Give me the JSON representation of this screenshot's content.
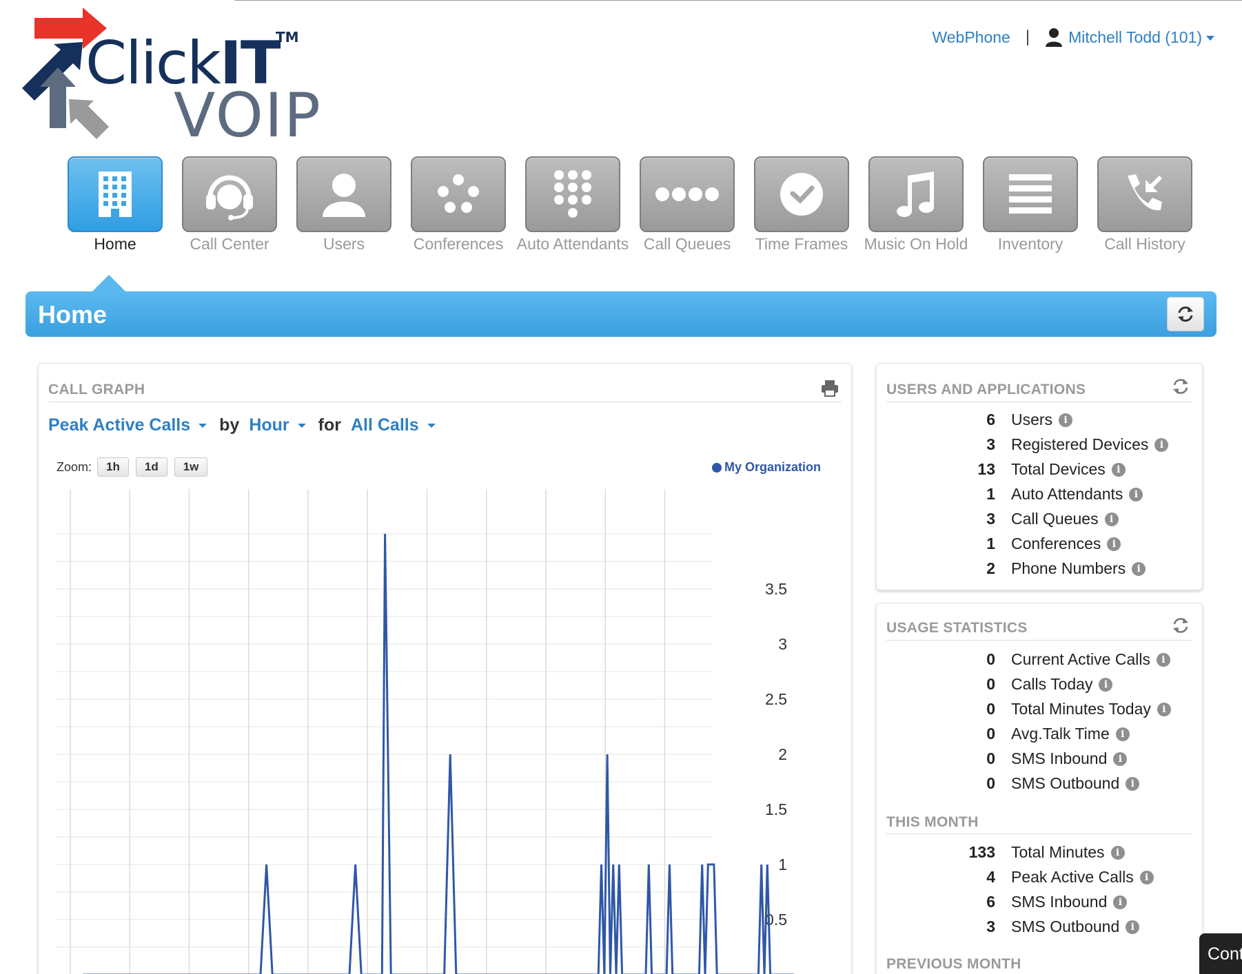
{
  "logo": {
    "word_click": "Click",
    "word_it": "IT",
    "tm": "TM",
    "word_voip": "VOIP"
  },
  "header": {
    "webphone": "WebPhone",
    "separator": "|",
    "user": "Mitchell Todd (101)"
  },
  "nav": [
    {
      "label": "Home",
      "icon": "building-icon",
      "active": true
    },
    {
      "label": "Call Center",
      "icon": "headset-icon",
      "active": false
    },
    {
      "label": "Users",
      "icon": "user-icon",
      "active": false
    },
    {
      "label": "Conferences",
      "icon": "conference-dots-icon",
      "active": false
    },
    {
      "label": "Auto Attendants",
      "icon": "keypad-icon",
      "active": false
    },
    {
      "label": "Call Queues",
      "icon": "queue-dots-icon",
      "active": false
    },
    {
      "label": "Time Frames",
      "icon": "clock-icon",
      "active": false
    },
    {
      "label": "Music On Hold",
      "icon": "music-note-icon",
      "active": false
    },
    {
      "label": "Inventory",
      "icon": "list-icon",
      "active": false
    },
    {
      "label": "Call History",
      "icon": "call-history-icon",
      "active": false
    }
  ],
  "page": {
    "title": "Home"
  },
  "call_graph": {
    "title": "CALL GRAPH",
    "metric": "Peak Active Calls",
    "by_word": "by",
    "period": "Hour",
    "for_word": "for",
    "filter": "All Calls",
    "zoom_label": "Zoom:",
    "zoom_options": [
      "1h",
      "1d",
      "1w"
    ],
    "legend": "My Organization"
  },
  "chart_data": {
    "type": "line",
    "series": [
      {
        "name": "My Organization",
        "color": "#2f57a8",
        "points": [
          [
            0,
            0
          ],
          [
            3,
            0
          ],
          [
            3.1,
            1
          ],
          [
            3.2,
            0
          ],
          [
            4.5,
            0
          ],
          [
            4.6,
            1
          ],
          [
            4.7,
            0
          ],
          [
            5.05,
            0
          ],
          [
            5.1,
            4
          ],
          [
            5.2,
            0
          ],
          [
            6.1,
            0
          ],
          [
            6.2,
            2
          ],
          [
            6.3,
            0
          ],
          [
            8.7,
            0
          ],
          [
            8.75,
            1
          ],
          [
            8.8,
            0
          ],
          [
            8.85,
            2
          ],
          [
            8.9,
            0
          ],
          [
            8.95,
            1
          ],
          [
            9.0,
            0
          ],
          [
            9.05,
            1
          ],
          [
            9.1,
            0
          ],
          [
            9.5,
            0
          ],
          [
            9.55,
            1
          ],
          [
            9.6,
            0
          ],
          [
            9.85,
            0
          ],
          [
            9.9,
            1
          ],
          [
            9.95,
            0
          ],
          [
            10.4,
            0
          ],
          [
            10.45,
            1
          ],
          [
            10.5,
            0
          ],
          [
            10.55,
            1
          ],
          [
            10.65,
            1
          ],
          [
            10.7,
            0
          ],
          [
            11.4,
            0
          ],
          [
            11.45,
            1
          ],
          [
            11.5,
            0
          ],
          [
            11.55,
            1
          ],
          [
            11.6,
            0
          ],
          [
            12,
            0
          ]
        ]
      }
    ],
    "x_range": [
      0,
      12
    ],
    "ylim": [
      0,
      4
    ],
    "y_ticks": [
      "0.5",
      "1",
      "1.5",
      "2",
      "2.5",
      "3",
      "3.5"
    ],
    "grid": true,
    "legend_position": "top-right"
  },
  "users_apps": {
    "title": "USERS AND APPLICATIONS",
    "rows": [
      {
        "value": "6",
        "label": "Users"
      },
      {
        "value": "3",
        "label": "Registered Devices"
      },
      {
        "value": "13",
        "label": "Total Devices"
      },
      {
        "value": "1",
        "label": "Auto Attendants"
      },
      {
        "value": "3",
        "label": "Call Queues"
      },
      {
        "value": "1",
        "label": "Conferences"
      },
      {
        "value": "2",
        "label": "Phone Numbers"
      }
    ]
  },
  "usage": {
    "title": "USAGE STATISTICS",
    "today": [
      {
        "value": "0",
        "label": "Current Active Calls"
      },
      {
        "value": "0",
        "label": "Calls Today"
      },
      {
        "value": "0",
        "label": "Total Minutes Today"
      },
      {
        "value": "0",
        "label": "Avg.Talk Time"
      },
      {
        "value": "0",
        "label": "SMS Inbound"
      },
      {
        "value": "0",
        "label": "SMS Outbound"
      }
    ],
    "this_month_title": "THIS MONTH",
    "this_month": [
      {
        "value": "133",
        "label": "Total Minutes"
      },
      {
        "value": "4",
        "label": "Peak Active Calls"
      },
      {
        "value": "6",
        "label": "SMS Inbound"
      },
      {
        "value": "3",
        "label": "SMS Outbound"
      }
    ],
    "previous_month_title": "PREVIOUS MONTH"
  },
  "cont_button": "Cont",
  "info_glyph": "i"
}
